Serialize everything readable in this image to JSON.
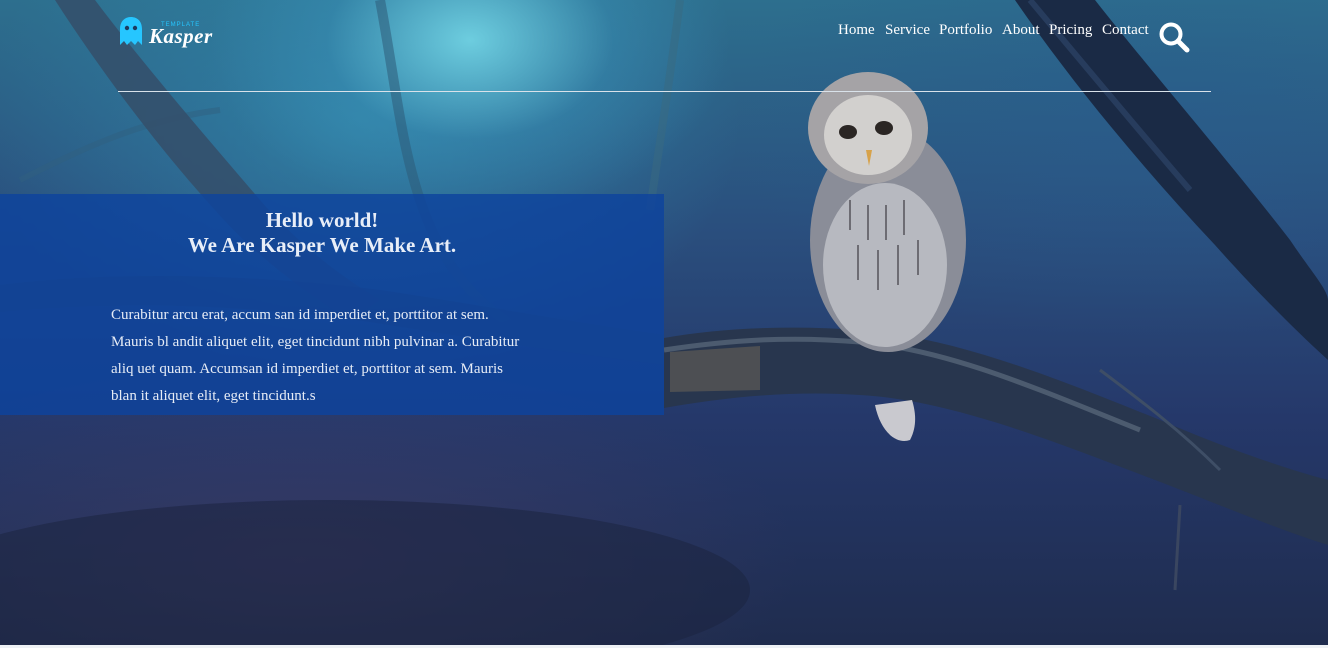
{
  "header": {
    "logo": {
      "brand_text": "Kasper",
      "tag_text": "TEMPLATE",
      "icon": "ghost-icon"
    },
    "nav": [
      {
        "label": "Home"
      },
      {
        "label": "Service"
      },
      {
        "label": "Portfolio"
      },
      {
        "label": "About"
      },
      {
        "label": "Pricing"
      },
      {
        "label": "Contact"
      }
    ],
    "search_icon": "search-icon"
  },
  "hero": {
    "title_line1": "Hello world!",
    "title_line2": "We Are Kasper We Make Art.",
    "paragraph": "Curabitur arcu erat, accum san id imperdiet et, porttitor at sem. Mauris bl andit aliquet elit, eget tincidunt nibh pulvinar a. Curabitur aliq uet quam. Accumsan id imperdiet et, porttitor at sem. Mauris blan it aliquet elit, eget tincidunt.s",
    "background_image": "owl perched on a branch in a blue forest"
  },
  "colors": {
    "accent": "#26c6ff",
    "panel": "#0e439e",
    "text": "#ffffff"
  }
}
